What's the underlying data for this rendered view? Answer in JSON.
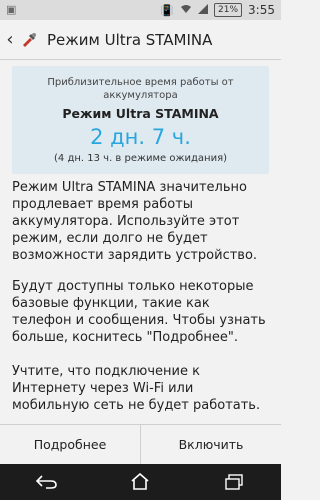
{
  "status_bar": {
    "battery": "21%",
    "time": "3:55"
  },
  "action_bar": {
    "title": "Режим Ultra STAMINA"
  },
  "info_card": {
    "caption": "Приблизительное время работы от аккумулятора",
    "mode": "Режим Ultra STAMINA",
    "time_remaining": "2 дн. 7 ч.",
    "standby": "(4 дн. 13 ч. в режиме ожидания)"
  },
  "description": {
    "paragraph_1": "Режим Ultra STAMINA значительно продлевает время работы аккумулятора. Используйте этот режим, если долго не будет возможности зарядить устройство.",
    "paragraph_2": "Будут доступны только некоторые базовые функции, такие как телефон и сообщения. Чтобы узнать больше, коснитесь \"Подробнее\".",
    "paragraph_3": "Учтите, что подключение к Интернету через Wi-Fi или мобильную сеть не будет работать."
  },
  "buttons": {
    "more_label": "Подробнее",
    "enable_label": "Включить"
  },
  "colors": {
    "accent": "#29a6dd",
    "card_bg": "#dfeaf0"
  }
}
